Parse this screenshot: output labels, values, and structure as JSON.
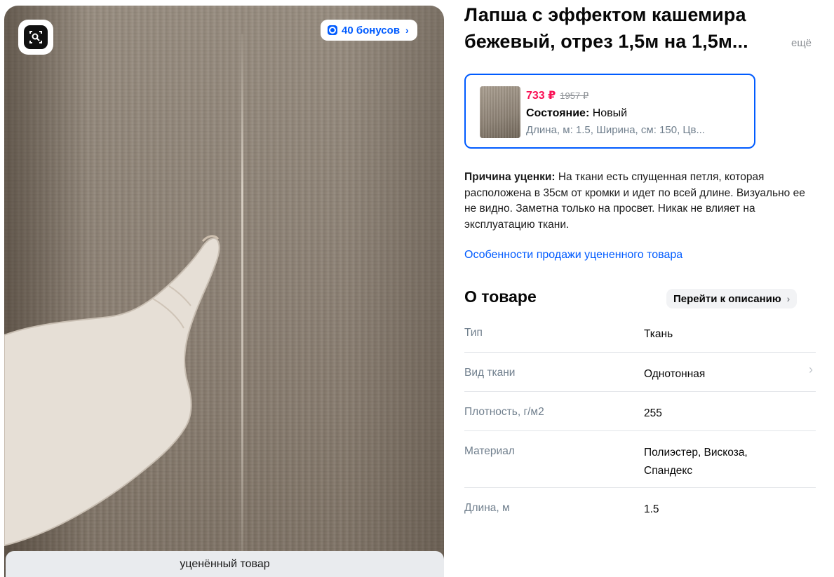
{
  "gallery": {
    "bonus_label": "40 бонусов",
    "discount_tag": "уценённый товар",
    "icons": [
      "photo-search-icon",
      "bonus-icon",
      "chevron-right-icon"
    ]
  },
  "product": {
    "title_line1": "Лапша с эффектом кашемира",
    "title_line2": "бежевый, отрез 1,5м на 1,5м...",
    "more_label": "ещё"
  },
  "offer": {
    "price_now": "733 ₽",
    "price_old": "1957 ₽",
    "state_label": "Состояние:",
    "state_value": "Новый",
    "props": "Длина, м: 1.5, Ширина, см: 150, Цв..."
  },
  "reason": {
    "label": "Причина уценки:",
    "text": "На ткани есть спущенная петля, которая расположена в 35см от кромки и идет по всей длине. Визуально ее не видно. Заметна только на просвет. Никак не влияет на эксплуатацию ткани."
  },
  "discount_link": "Особенности продажи уцененного товара",
  "about": {
    "title": "О товаре",
    "to_description": "Перейти к описанию",
    "specs": [
      {
        "name": "Тип",
        "value": "Ткань"
      },
      {
        "name": "Вид ткани",
        "value": "Однотонная"
      },
      {
        "name": "Плотность, г/м2",
        "value": "255"
      },
      {
        "name": "Материал",
        "value": "Полиэстер, Вискоза, Спандекс"
      },
      {
        "name": "Длина, м",
        "value": "1.5"
      }
    ]
  },
  "colors": {
    "accent": "#005bff",
    "price": "#f91155",
    "muted": "#707f8d"
  }
}
